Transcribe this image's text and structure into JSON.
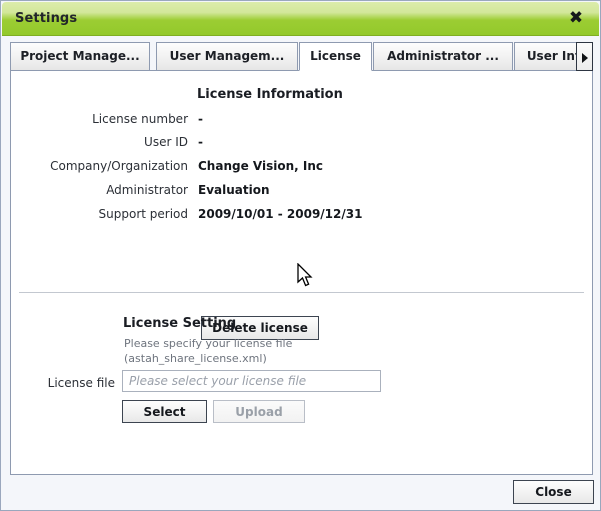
{
  "window": {
    "title": "Settings",
    "close_icon": "close-icon",
    "close_glyph": "✖",
    "accent_color": "#9ccd33",
    "border_color": "#8e9ab0"
  },
  "tabs": {
    "items": [
      {
        "label": "Project Manage...",
        "active": false
      },
      {
        "label": "User Managem...",
        "active": false
      },
      {
        "label": "License",
        "active": true
      },
      {
        "label": "Administrator ...",
        "active": false
      },
      {
        "label": "User Inf",
        "active": false
      }
    ],
    "scroll_right_icon": "chevron-right-icon"
  },
  "license_info": {
    "heading": "License Information",
    "rows": [
      {
        "label": "License number",
        "value": "-"
      },
      {
        "label": "User ID",
        "value": "-"
      },
      {
        "label": "Company/Organization",
        "value": "Change Vision, Inc"
      },
      {
        "label": "Administrator",
        "value": "Evaluation"
      },
      {
        "label": "Support period",
        "value": "2009/10/01 - 2009/12/31"
      }
    ],
    "delete_button": "Delete license"
  },
  "license_setting": {
    "heading": "License Setting",
    "help_line1": "Please specify your license file",
    "help_line2": "(astah_share_license.xml)",
    "file_label": "License file",
    "file_value": "",
    "file_placeholder": "Please select your license file",
    "select_button": "Select",
    "upload_button": "Upload"
  },
  "footer": {
    "close_button": "Close"
  }
}
